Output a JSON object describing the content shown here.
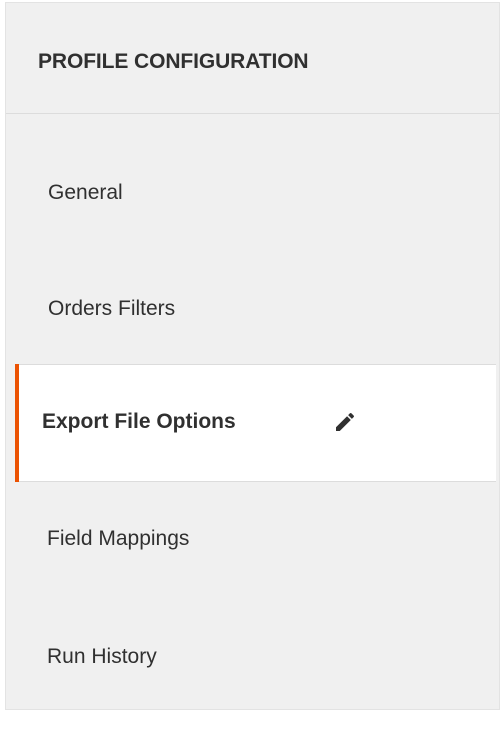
{
  "panel": {
    "title": "PROFILE CONFIGURATION"
  },
  "nav": {
    "items": [
      {
        "label": "General",
        "active": false
      },
      {
        "label": "Orders Filters",
        "active": false
      },
      {
        "label": "Export File Options",
        "active": true,
        "icon": "pencil-icon"
      },
      {
        "label": "Field Mappings",
        "active": false
      },
      {
        "label": "Run History",
        "active": false
      }
    ],
    "accent_color": "#eb5202"
  }
}
